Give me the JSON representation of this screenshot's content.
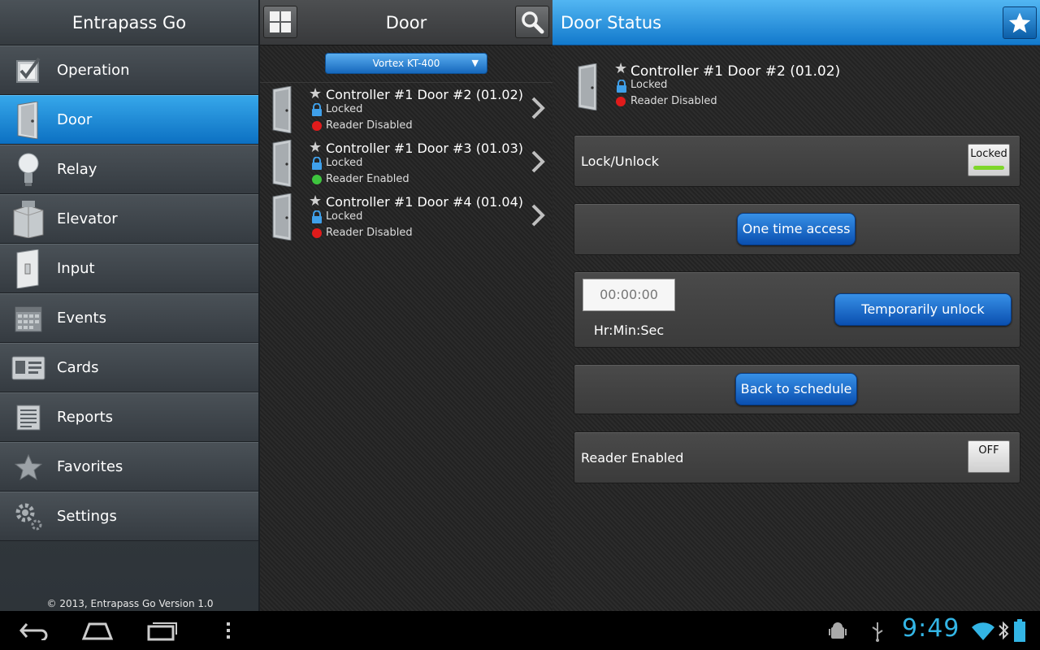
{
  "sidebar": {
    "app_title": "Entrapass Go",
    "items": [
      {
        "label": "Operation",
        "icon": "checkbox-icon"
      },
      {
        "label": "Door",
        "icon": "door-icon"
      },
      {
        "label": "Relay",
        "icon": "lightbulb-icon"
      },
      {
        "label": "Elevator",
        "icon": "elevator-icon"
      },
      {
        "label": "Input",
        "icon": "switch-icon"
      },
      {
        "label": "Events",
        "icon": "calendar-icon"
      },
      {
        "label": "Cards",
        "icon": "id-card-icon"
      },
      {
        "label": "Reports",
        "icon": "report-icon"
      },
      {
        "label": "Favorites",
        "icon": "star-icon"
      },
      {
        "label": "Settings",
        "icon": "gear-icon"
      }
    ],
    "active": "Door",
    "copyright": "© 2013, Entrapass Go Version 1.0"
  },
  "door_panel": {
    "title": "Door",
    "controller": "Vortex KT-400",
    "doors": [
      {
        "name": "Controller #1 Door #2 (01.02)",
        "lock_state": "Locked",
        "reader_state": "Reader Disabled",
        "reader_color": "#e01b1b"
      },
      {
        "name": "Controller #1 Door #3 (01.03)",
        "lock_state": "Locked",
        "reader_state": "Reader Enabled",
        "reader_color": "#3ec43e"
      },
      {
        "name": "Controller #1 Door #4 (01.04)",
        "lock_state": "Locked",
        "reader_state": "Reader Disabled",
        "reader_color": "#e01b1b"
      }
    ]
  },
  "status_panel": {
    "title": "Door Status",
    "door": {
      "name": "Controller #1 Door #2 (01.02)",
      "lock_state": "Locked",
      "reader_state": "Reader Disabled",
      "reader_color": "#e01b1b"
    },
    "lock_unlock": {
      "label": "Lock/Unlock",
      "toggle": "Locked",
      "bar_color": "#7ed62a"
    },
    "one_time_access": "One time access",
    "timer": {
      "value": "00:00:00",
      "label": "Hr:Min:Sec",
      "button": "Temporarily unlock"
    },
    "back_to_schedule": "Back to schedule",
    "reader": {
      "label": "Reader Enabled",
      "toggle": "OFF",
      "bar_color": "#d8d8d8"
    }
  },
  "system_bar": {
    "clock": "9:49",
    "accent": "#33b5e5"
  }
}
